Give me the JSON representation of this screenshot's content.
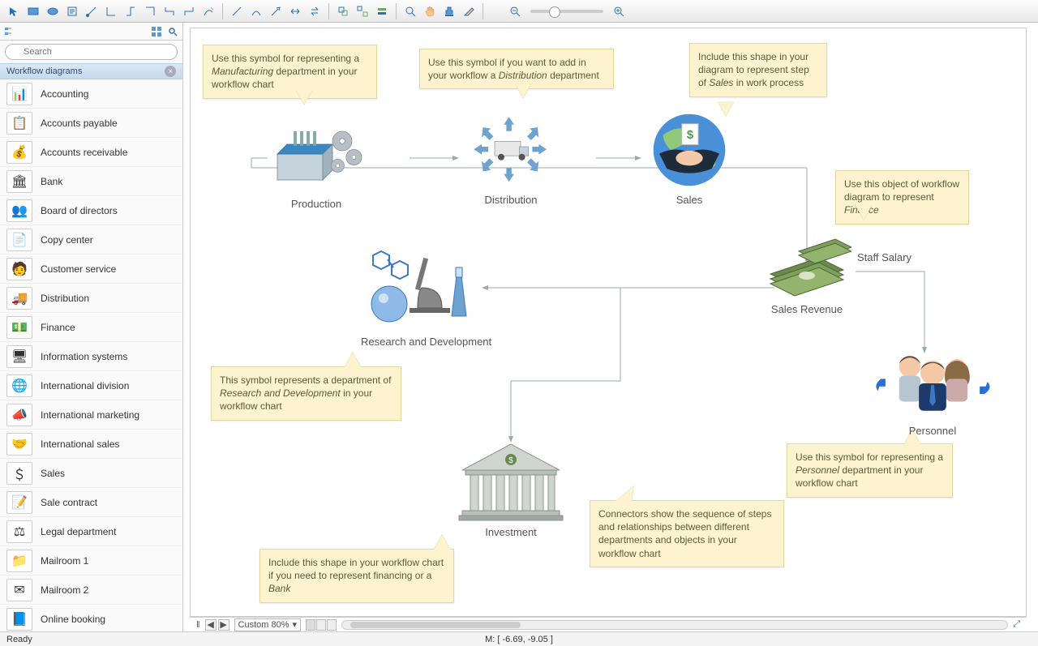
{
  "toolbar": {
    "icons": [
      "☝",
      "▭",
      "◯",
      "▤",
      "⇱",
      "⌐",
      "⊏",
      "⊐",
      "⊓",
      "⊔",
      "✎",
      "│",
      "↘",
      "∿",
      "↕",
      "⇆",
      "│",
      "◻",
      "⬚",
      "⬛",
      "│",
      "🔍",
      "✋",
      "👤",
      "✎",
      "│",
      "⊖",
      "—",
      "⊕"
    ]
  },
  "sidebar": {
    "search_placeholder": "Search",
    "section_title": "Workflow diagrams",
    "items": [
      {
        "icon": "📊",
        "label": "Accounting"
      },
      {
        "icon": "📋",
        "label": "Accounts payable"
      },
      {
        "icon": "💰",
        "label": "Accounts receivable"
      },
      {
        "icon": "🏛",
        "label": "Bank"
      },
      {
        "icon": "👥",
        "label": "Board of directors"
      },
      {
        "icon": "📄",
        "label": "Copy center"
      },
      {
        "icon": "🧑",
        "label": "Customer service"
      },
      {
        "icon": "🚚",
        "label": "Distribution"
      },
      {
        "icon": "💵",
        "label": "Finance"
      },
      {
        "icon": "🖥",
        "label": "Information systems"
      },
      {
        "icon": "🌐",
        "label": "International division"
      },
      {
        "icon": "📣",
        "label": "International marketing"
      },
      {
        "icon": "🤝",
        "label": "International sales"
      },
      {
        "icon": "＄",
        "label": "Sales"
      },
      {
        "icon": "📝",
        "label": "Sale contract"
      },
      {
        "icon": "⚖",
        "label": "Legal department"
      },
      {
        "icon": "📁",
        "label": "Mailroom 1"
      },
      {
        "icon": "✉",
        "label": "Mailroom 2"
      },
      {
        "icon": "📘",
        "label": "Online booking"
      }
    ]
  },
  "canvas": {
    "nodes": {
      "production": "Production",
      "distribution": "Distribution",
      "sales": "Sales",
      "sales_revenue": "Sales Revenue",
      "staff_salary": "Staff Salary",
      "rnd": "Research and Development",
      "investment": "Investment",
      "personnel": "Personnel"
    },
    "callouts": {
      "c_production": "Use this symbol for representing a <em>Manufacturing</em> department in your workflow chart",
      "c_distribution": "Use this symbol if you want to add in your workflow a <em>Distribution</em> department",
      "c_sales": "Include this shape in your diagram to represent step of <em>Sales</em> in work process",
      "c_finance": "Use this object of workflow diagram to represent <em>Finance</em>",
      "c_rnd": "This symbol represents a department of <em>Research and Development</em> in your workflow chart",
      "c_personnel": "Use this symbol for representing a <em>Personnel</em> department in your workflow chart",
      "c_investment": "Include this shape in your workflow chart if you need to represent financing or a <em>Bank</em>",
      "c_connectors": "Connectors show the sequence of steps and relationships between different departments and objects in your workflow chart"
    }
  },
  "bottom": {
    "zoom_label": "Custom 80%"
  },
  "status": {
    "ready": "Ready",
    "coord": "M: [ -6.69, -9.05 ]"
  }
}
